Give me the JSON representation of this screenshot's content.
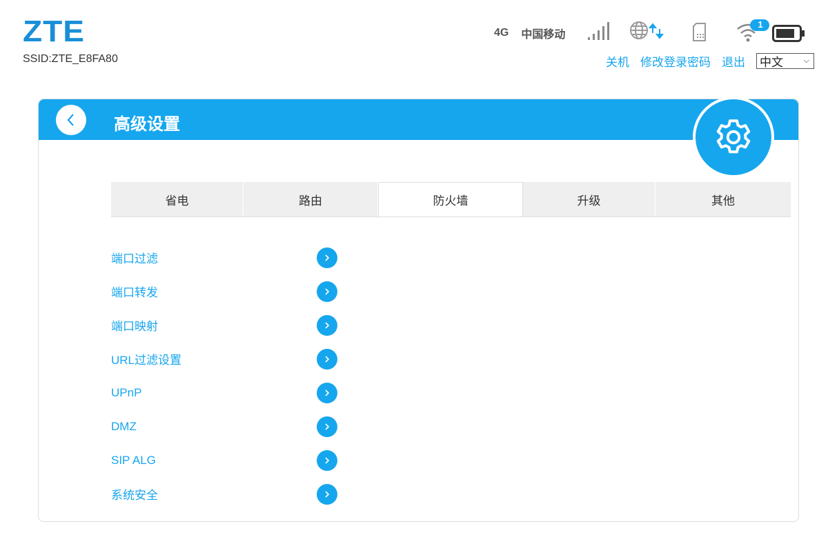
{
  "header": {
    "logo": "ZTE",
    "ssid": "SSID:ZTE_E8FA80",
    "network_type": "4G",
    "carrier": "中国移动",
    "wifi_clients": "1",
    "links": {
      "shutdown": "关机",
      "change_password": "修改登录密码",
      "logout": "退出"
    },
    "language": "中文"
  },
  "page": {
    "title": "高级设置"
  },
  "tabs": [
    {
      "label": "省电"
    },
    {
      "label": "路由"
    },
    {
      "label": "防火墙"
    },
    {
      "label": "升级"
    },
    {
      "label": "其他"
    }
  ],
  "active_tab": "防火墙",
  "items": [
    {
      "label": "端口过滤"
    },
    {
      "label": "端口转发"
    },
    {
      "label": "端口映射"
    },
    {
      "label": "URL过滤设置"
    },
    {
      "label": "UPnP"
    },
    {
      "label": "DMZ"
    },
    {
      "label": "SIP ALG"
    },
    {
      "label": "系统安全"
    }
  ],
  "colors": {
    "accent": "#16a6ee",
    "logo": "#1a8fd8"
  }
}
